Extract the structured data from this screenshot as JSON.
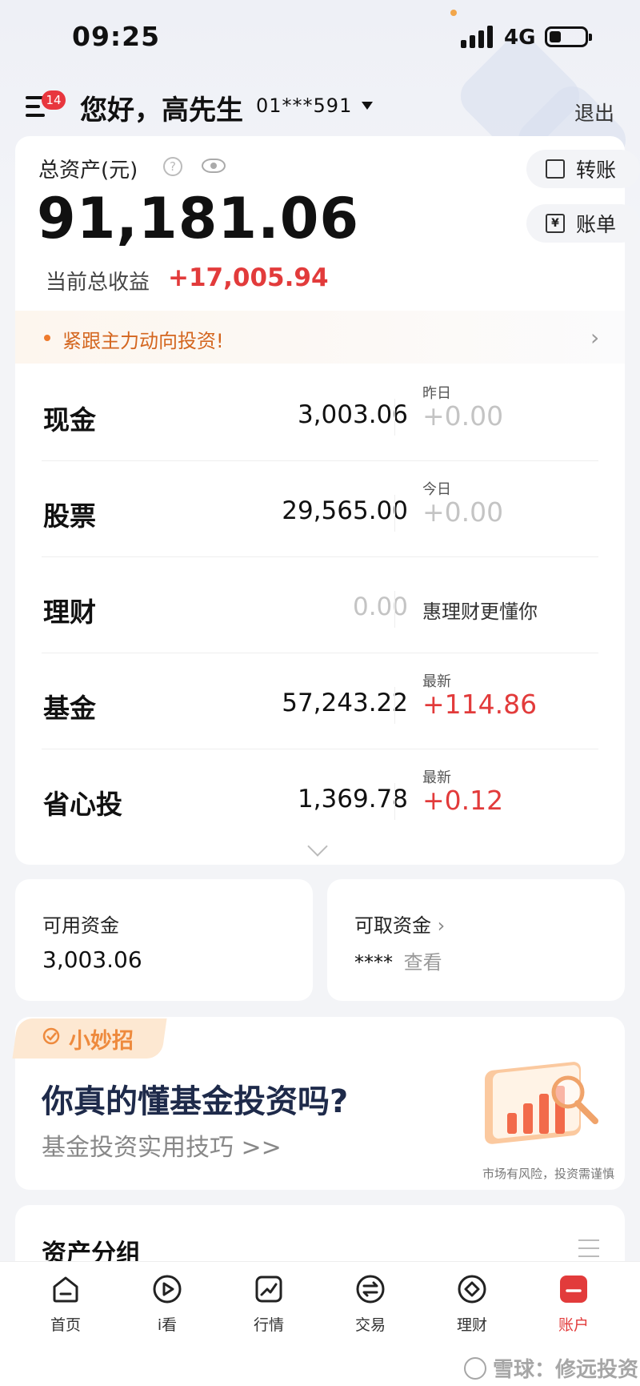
{
  "status_bar": {
    "time": "09:25",
    "network": "4G"
  },
  "header": {
    "badge_count": "14",
    "greeting": "您好，高先生",
    "account": "01***591",
    "logout": "退出"
  },
  "assets": {
    "label": "总资产(元)",
    "total": "91,181.06",
    "profit_label": "当前总收益",
    "profit_value": "+17,005.94",
    "transfer": "转账",
    "bill": "账单",
    "transfer_icon": "transfer-icon",
    "bill_icon": "bill-icon"
  },
  "banner": {
    "text": "紧跟主力动向投资!"
  },
  "rows": [
    {
      "name": "现金",
      "amount": "3,003.06",
      "sub": "昨日",
      "delta": "+0.00"
    },
    {
      "name": "股票",
      "amount": "29,565.00",
      "sub": "今日",
      "delta": "+0.00"
    },
    {
      "name": "理财",
      "amount": "0.00",
      "sub": "",
      "delta": "惠理财更懂你"
    },
    {
      "name": "基金",
      "amount": "57,243.22",
      "sub": "最新",
      "delta": "+114.86"
    },
    {
      "name": "省心投",
      "amount": "1,369.78",
      "sub": "最新",
      "delta": "+0.12"
    }
  ],
  "funds": {
    "available_label": "可用资金",
    "available_value": "3,003.06",
    "withdrawable_label": "可取资金",
    "withdrawable_mask": "****",
    "withdrawable_link": "查看"
  },
  "promo": {
    "tag": "小妙招",
    "title": "你真的懂基金投资吗?",
    "subtitle": "基金投资实用技巧 >>",
    "risk": "市场有风险，投资需谨慎"
  },
  "group": {
    "title": "资产分组"
  },
  "tabs": [
    {
      "label": "首页",
      "icon": "home-icon"
    },
    {
      "label": "i看",
      "icon": "play-icon"
    },
    {
      "label": "行情",
      "icon": "chart-icon"
    },
    {
      "label": "交易",
      "icon": "trade-icon"
    },
    {
      "label": "理财",
      "icon": "finance-icon"
    },
    {
      "label": "账户",
      "icon": "account-icon"
    }
  ],
  "watermark": "雪球：修远投资",
  "colors": {
    "accent_red": "#e23b3b",
    "banner_orange": "#d4661f",
    "promo_orange": "#ee8a3d"
  }
}
